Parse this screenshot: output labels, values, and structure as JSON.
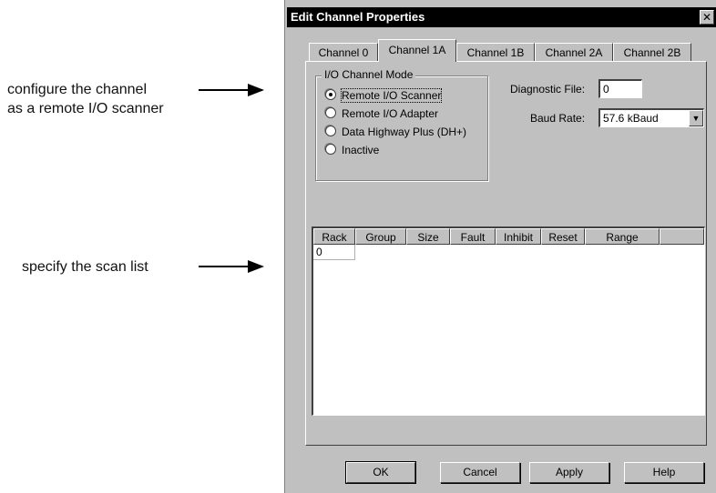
{
  "annotations": {
    "configure": "configure the channel\nas a remote I/O scanner",
    "scan_list": "specify the scan list"
  },
  "dialog": {
    "title": "Edit Channel Properties",
    "close_glyph": "✕",
    "tabs": [
      "Channel 0",
      "Channel 1A",
      "Channel 1B",
      "Channel 2A",
      "Channel 2B"
    ],
    "active_tab": "Channel 1A",
    "mode_group": {
      "title": "I/O Channel Mode",
      "options": [
        "Remote I/O Scanner",
        "Remote I/O Adapter",
        "Data Highway Plus (DH+)",
        "Inactive"
      ],
      "selected": "Remote I/O Scanner"
    },
    "diagnostic_file": {
      "label": "Diagnostic File:",
      "value": "0"
    },
    "baud_rate": {
      "label": "Baud Rate:",
      "value": "57.6 kBaud",
      "arrow_glyph": "▼"
    },
    "scan_list": {
      "columns": [
        "Rack",
        "Group",
        "Size",
        "Fault",
        "Inhibit",
        "Reset",
        "Range"
      ],
      "rows": [
        [
          "0"
        ]
      ]
    },
    "buttons": {
      "ok": "OK",
      "cancel": "Cancel",
      "apply": "Apply",
      "help": "Help"
    }
  }
}
